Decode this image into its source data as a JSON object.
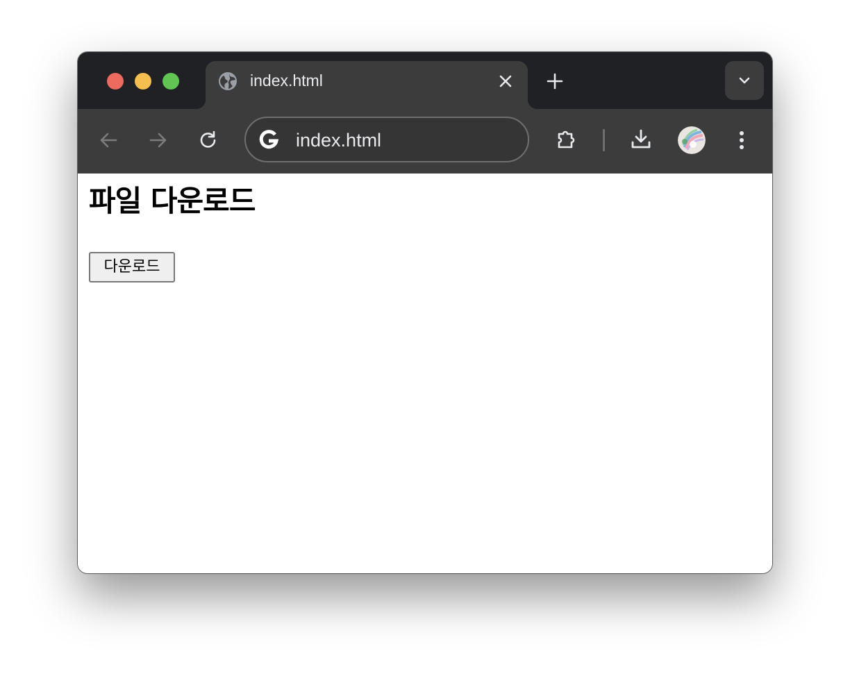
{
  "browser": {
    "tab": {
      "title": "index.html",
      "favicon": "globe-icon",
      "close_icon": "close-icon"
    },
    "new_tab_icon": "plus-icon",
    "tab_search_icon": "chevron-down-icon",
    "toolbar": {
      "back_icon": "arrow-left-icon",
      "forward_icon": "arrow-right-icon",
      "reload_icon": "reload-icon",
      "omnibox": {
        "icon": "google-g-icon",
        "url": "index.html"
      },
      "extensions_icon": "puzzle-icon",
      "download_icon": "download-icon",
      "profile_icon": "avatar",
      "menu_icon": "three-dot-menu-icon"
    },
    "colors": {
      "titlebar": "#202124",
      "toolbar": "#3c3c3c",
      "traffic_red": "#ed6a5e",
      "traffic_yellow": "#f5bf4f",
      "traffic_green": "#61c554"
    }
  },
  "page": {
    "heading": "파일 다운로드",
    "download_button_label": "다운로드"
  }
}
